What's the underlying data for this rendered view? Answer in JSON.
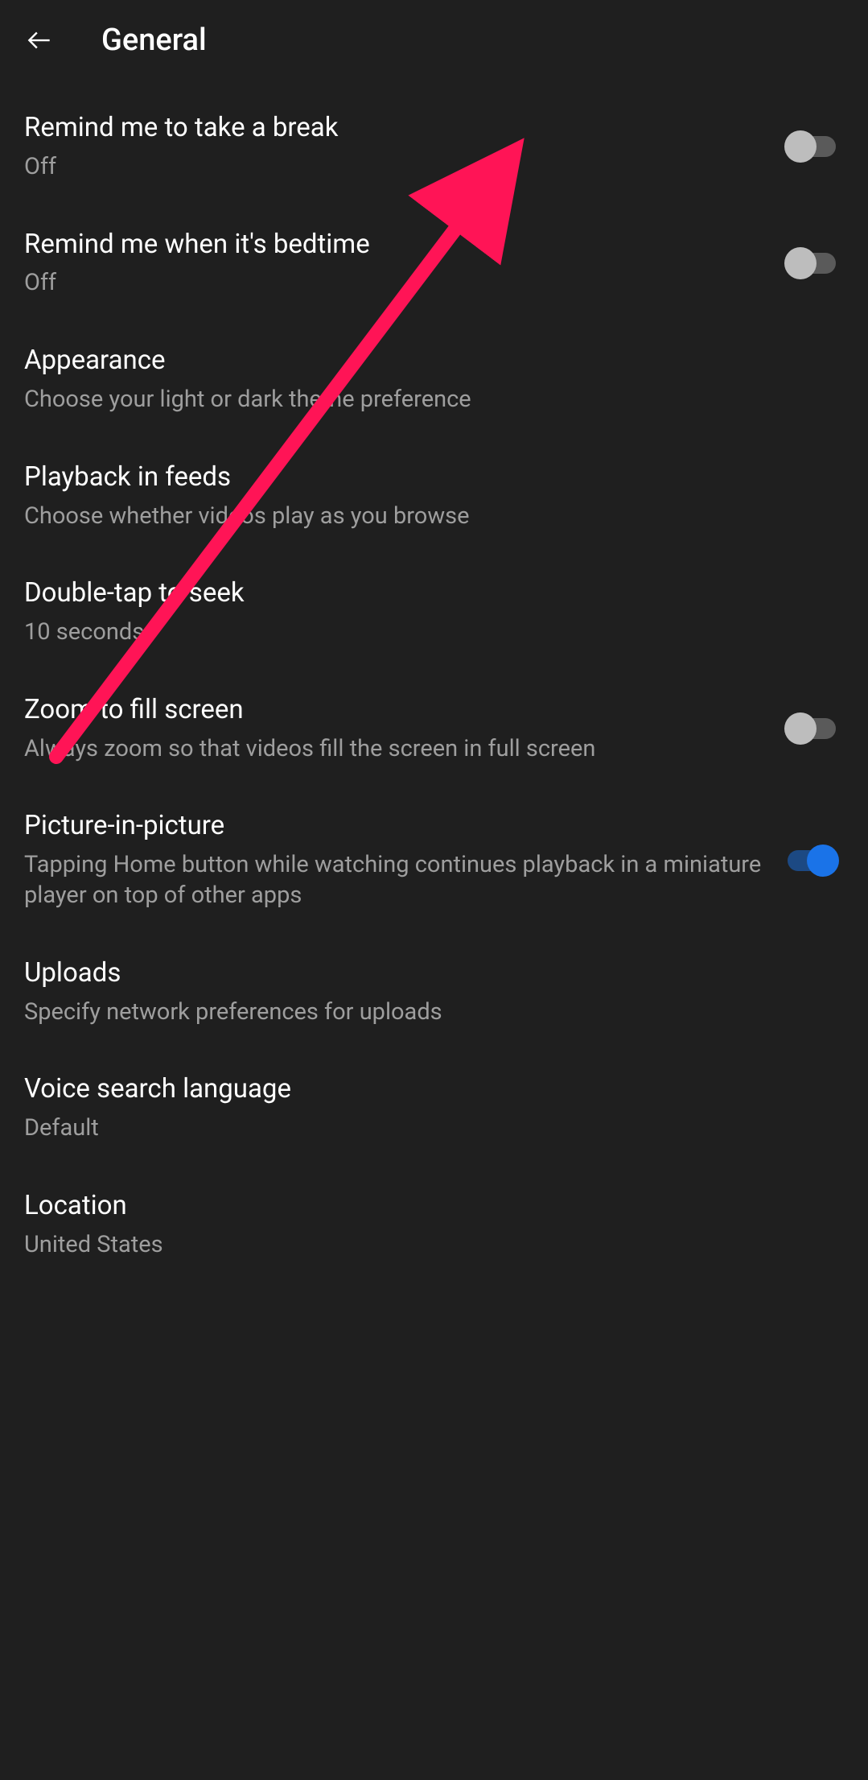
{
  "header": {
    "title": "General"
  },
  "settings": {
    "takeBreak": {
      "title": "Remind me to take a break",
      "subtitle": "Off",
      "enabled": false
    },
    "bedtime": {
      "title": "Remind me when it's bedtime",
      "subtitle": "Off",
      "enabled": false
    },
    "appearance": {
      "title": "Appearance",
      "subtitle": "Choose your light or dark theme preference"
    },
    "playbackFeeds": {
      "title": "Playback in feeds",
      "subtitle": "Choose whether videos play as you browse"
    },
    "doubleTap": {
      "title": "Double-tap to seek",
      "subtitle": "10 seconds"
    },
    "zoomFill": {
      "title": "Zoom to fill screen",
      "subtitle": "Always zoom so that videos fill the screen in full screen",
      "enabled": false
    },
    "pip": {
      "title": "Picture-in-picture",
      "subtitle": "Tapping Home button while watching continues playback in a miniature player on top of other apps",
      "enabled": true
    },
    "uploads": {
      "title": "Uploads",
      "subtitle": "Specify network preferences for uploads"
    },
    "voiceSearch": {
      "title": "Voice search language",
      "subtitle": "Default"
    },
    "location": {
      "title": "Location",
      "subtitle": "United States"
    }
  }
}
